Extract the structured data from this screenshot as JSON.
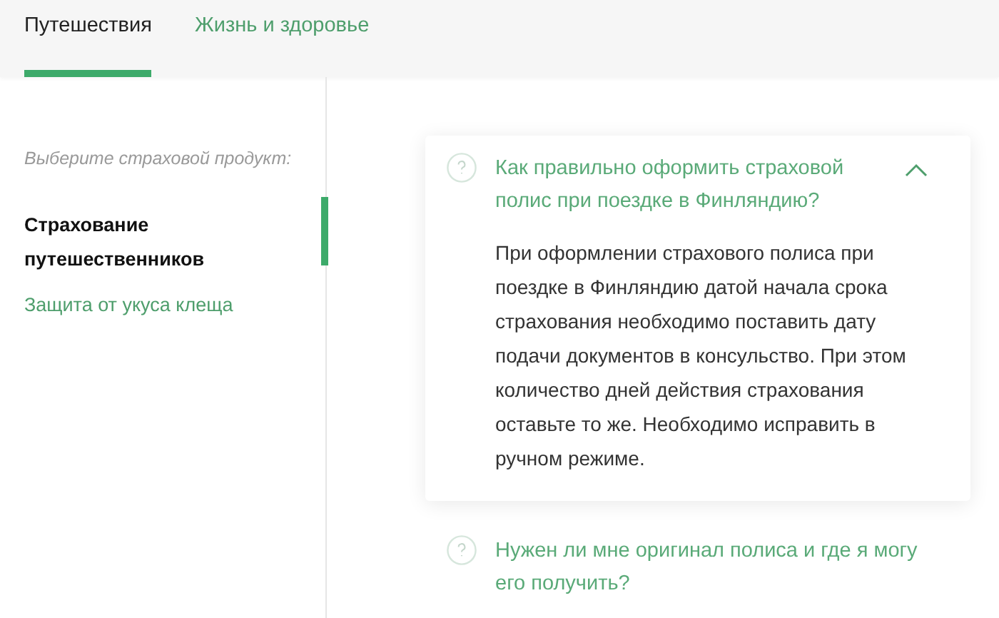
{
  "tabs": [
    {
      "label": "Путешествия",
      "selected": true
    },
    {
      "label": "Жизнь и здоровье",
      "selected": false
    }
  ],
  "sidebar": {
    "hint": "Выберите страховой продукт:",
    "items": [
      {
        "label": "Страхование путешественников",
        "selected": true
      },
      {
        "label": "Защита от укуса клеща",
        "selected": false
      }
    ]
  },
  "faq": [
    {
      "question": "Как правильно оформить страховой полис при поездке в Финляндию?",
      "expanded": true,
      "answer": "При оформлении страхового полиса при поездке в Финляндию датой начала срока страхования необходимо поставить дату подачи документов в консульство. При этом количество дней действия страхования оставьте то же. Необходимо исправить в ручном режиме."
    },
    {
      "question": "Нужен ли мне оригинал полиса и где я могу его получить?",
      "expanded": false
    }
  ]
}
